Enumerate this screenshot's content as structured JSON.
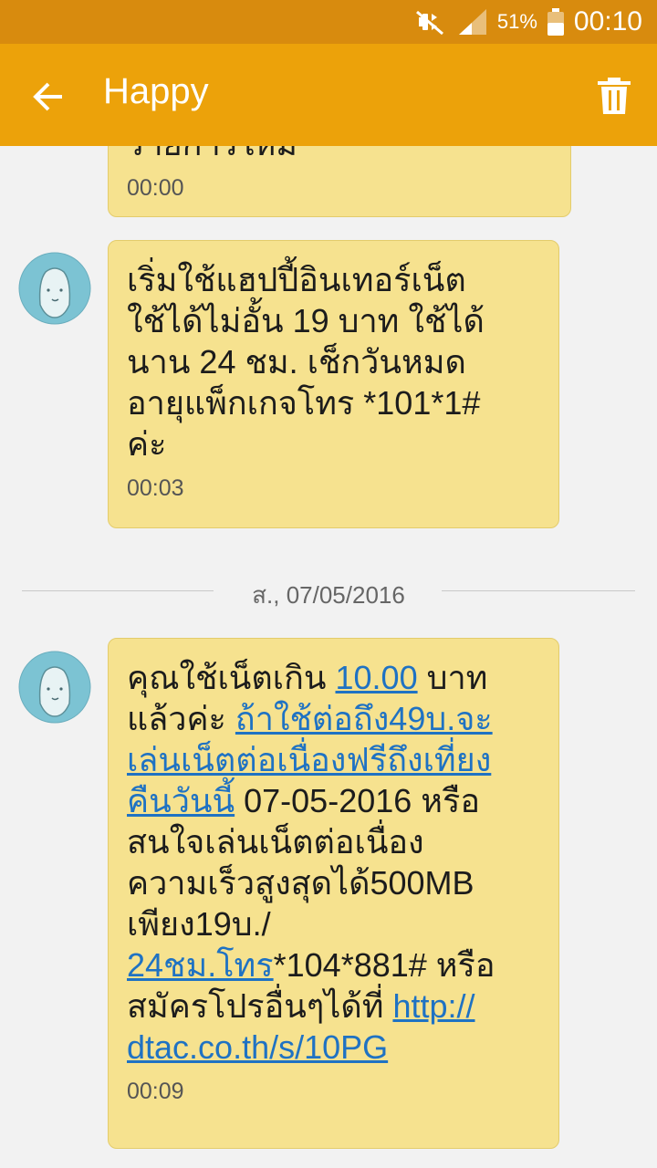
{
  "status_bar": {
    "battery_percent": "51%",
    "time": "00:10"
  },
  "app_bar": {
    "title": "Happy"
  },
  "messages": [
    {
      "text": "รายการใหม่",
      "time": "00:00"
    },
    {
      "text": "เริ่มใช้แฮปปี้อินเทอร์เน็ต\nใช้ได้ไม่อั้น 19 บาท ใช้ได้\nนาน 24 ชม. เช็กวันหมด\nอายุแพ็กเกจโทร *101*1#\nค่ะ",
      "time": "00:03"
    },
    {
      "time": "00:09",
      "parts": {
        "p1": "คุณใช้เน็ตเกิน ",
        "l1": "10.00",
        "p2": " บาท\nแล้วค่ะ ",
        "l2": "ถ้าใช้ต่อถึง49บ.จะ\nเล่นเน็ตต่อเนื่องฟรีถึงเที่ยง\nคืนวันนี้",
        "p3": " 07-05-2016 หรือ\nสนใจเล่นเน็ตต่อเนื่อง\nความเร็วสูงสุดได้500MB\nเพียง19บ./\n",
        "l3": "24ชม.โทร",
        "p4": "*104*881# หรือ\nสมัครโปรอื่นๆได้ที่ ",
        "l4": "http://\ndtac.co.th/s/10PG"
      }
    }
  ],
  "date_divider": "ส., 07/05/2016",
  "colors": {
    "status_bar": "#d88b0e",
    "app_bar": "#eca20a",
    "bubble": "#f6e28f",
    "link": "#1f72c3",
    "avatar_bg": "#7cc3d3",
    "avatar_face": "#e8f3f4"
  },
  "icons": [
    "back-arrow-icon",
    "delete-icon",
    "mute-icon",
    "signal-icon",
    "battery-icon",
    "contact-avatar-icon"
  ]
}
